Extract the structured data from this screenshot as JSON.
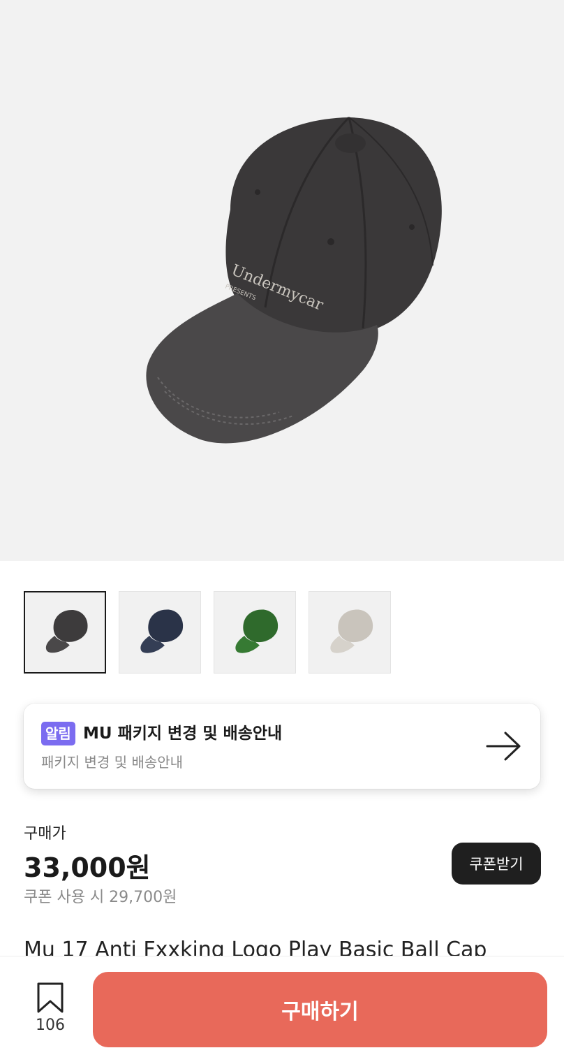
{
  "product": {
    "image_icon": "black-ball-cap-image",
    "brand_text": "Undermycar",
    "brand_subtext": "PRESENTS",
    "name": "Mu 17 Anti Fxxking Logo Play Basic Ball Cap"
  },
  "thumbnails": [
    {
      "name": "black-cap-thumb",
      "color": "#3d3b3c",
      "selected": true
    },
    {
      "name": "navy-cap-thumb",
      "color": "#2a3348",
      "selected": false
    },
    {
      "name": "green-cap-thumb",
      "color": "#2f6a2c",
      "selected": false
    },
    {
      "name": "beige-cap-thumb",
      "color": "#c9c4bc",
      "selected": false
    }
  ],
  "notice": {
    "badge": "알림",
    "title": "MU 패키지 변경 및 배송안내",
    "subtitle": "패키지 변경 및 배송안내",
    "arrow_icon": "arrow-right-icon"
  },
  "pricing": {
    "label": "구매가",
    "price": "33,000원",
    "coupon_text": "쿠폰 사용 시 29,700원",
    "coupon_button": "쿠폰받기"
  },
  "bottom_bar": {
    "bookmark_icon": "bookmark-icon",
    "bookmark_count": "106",
    "buy_button": "구매하기"
  },
  "colors": {
    "accent": "#e8695a",
    "badge": "#7b6cf0",
    "dark_button": "#1f1f1f"
  }
}
